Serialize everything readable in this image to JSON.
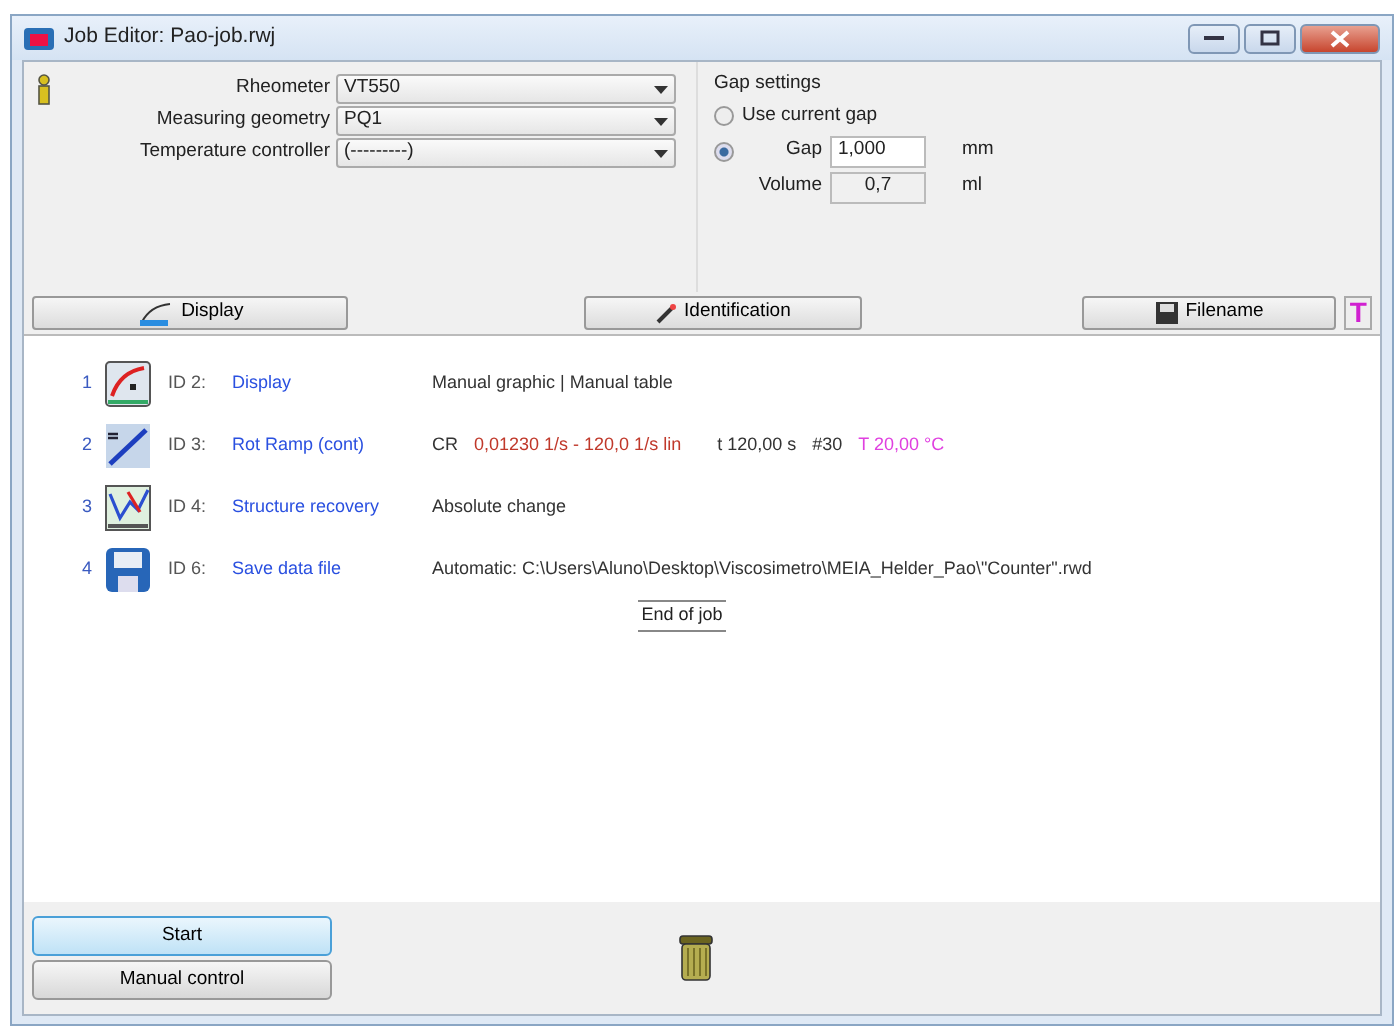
{
  "window": {
    "title": "Job Editor: Pao-job.rwj"
  },
  "devices": [
    {
      "label": "Rheometer",
      "value": "VT550"
    },
    {
      "label": "Measuring geometry",
      "value": "PQ1"
    },
    {
      "label": "Temperature controller",
      "value": "(---------)"
    }
  ],
  "gap_settings": {
    "title": "Gap settings",
    "options": [
      {
        "label": "Use current gap",
        "selected": false
      },
      {
        "label": "Gap",
        "selected": true,
        "value": "1,000",
        "unit": "mm"
      }
    ],
    "volume": {
      "label": "Volume",
      "value": "0,7",
      "unit": "ml"
    }
  },
  "toolbar": [
    {
      "label": "Display",
      "kind": "display"
    },
    {
      "label": "Identification",
      "kind": "identification"
    },
    {
      "label": "Filename",
      "kind": "filename"
    }
  ],
  "text_button": {
    "label": "T"
  },
  "steps": [
    {
      "number": "1",
      "kind": "display",
      "id": "ID 2:",
      "name": "Display",
      "details": [
        {
          "text": "Manual graphic | Manual table",
          "color": "#333333"
        }
      ]
    },
    {
      "number": "2",
      "kind": "ramp",
      "id": "ID 3:",
      "name": "Rot Ramp (cont)",
      "details": [
        {
          "text": "CR",
          "color": "#333333"
        },
        {
          "text": "0,01230 1/s - 120,0 1/s lin",
          "color": "#c0392b"
        },
        {
          "text": "t 120,00 s",
          "color": "#333333"
        },
        {
          "text": "#30",
          "color": "#333333"
        },
        {
          "text": "T 20,00 °C",
          "color": "#e040e0"
        }
      ]
    },
    {
      "number": "3",
      "kind": "recovery",
      "id": "ID 4:",
      "name": "Structure recovery",
      "details": [
        {
          "text": "Absolute change",
          "color": "#333333"
        }
      ]
    },
    {
      "number": "4",
      "kind": "save",
      "id": "ID 6:",
      "name": "Save data file",
      "details": [
        {
          "text": "Automatic: C:\\Users\\Aluno\\Desktop\\Viscosimetro\\MEIA_Helder_Pao\\\"Counter\".rwd",
          "color": "#333333"
        }
      ]
    }
  ],
  "end_marker": "End of job",
  "buttons": [
    {
      "label": "Start",
      "selected": true
    },
    {
      "label": "Manual control",
      "selected": false
    }
  ]
}
